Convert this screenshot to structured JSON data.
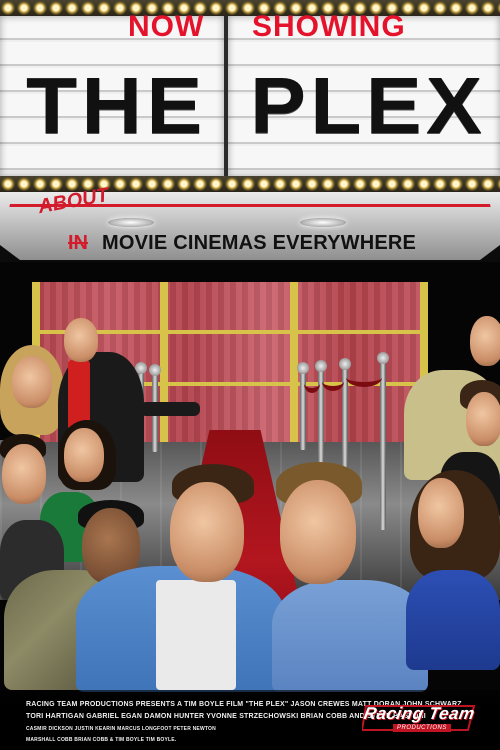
{
  "marquee": {
    "now": "NOW",
    "showing": "SHOWING",
    "title_left": "THE",
    "title_right": "PLEX"
  },
  "tagline": {
    "inserted_word": "ABOUT",
    "struck_word": "IN",
    "text": "MOVIE CINEMAS EVERYWHERE"
  },
  "credits": {
    "line1": "RACING TEAM PRODUCTIONS PRESENTS A TIM BOYLE FILM \"THE PLEX\" JASON CREWES MATT DORAN JOHN SCHWARZ",
    "line2": "TORI HARTIGAN GABRIEL EGAN DAMON HUNTER YVONNE STRZECHOWSKI BRIAN COBB AND STEVE BASTONI",
    "line3": "CASMIR DICKSON   JUSTIN KEARIN   MARCUS LONGFOOT   PETER NEWTON",
    "line4": "MARSHALL COBB   BRIAN COBB & TIM BOYLE   TIM BOYLE."
  },
  "logo": {
    "text": "Racing Team",
    "sub": "PRODUCTIONS"
  },
  "colors": {
    "marquee_red": "#e4122a",
    "title_black": "#111111",
    "carpet_red": "#b3161f",
    "curtain_red": "#c75b65",
    "gold": "#d7c24a"
  }
}
